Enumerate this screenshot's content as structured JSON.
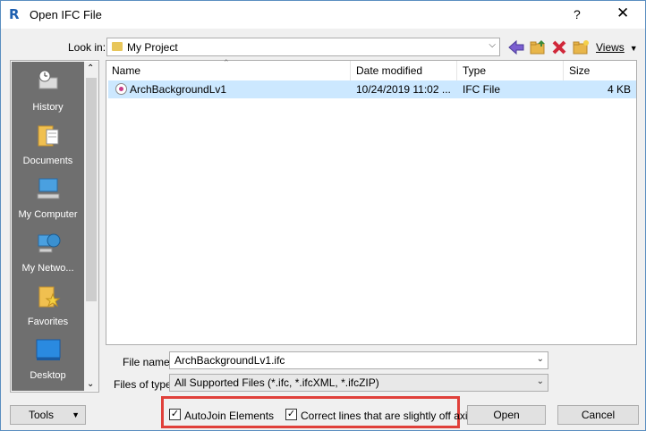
{
  "window": {
    "title": "Open IFC File",
    "app_icon_letter": "R",
    "help_glyph": "?",
    "close_glyph": "✕"
  },
  "lookin": {
    "label": "Look in:",
    "value": "My Project"
  },
  "toolbar": {
    "views_label": "Views"
  },
  "places": [
    {
      "label": "History"
    },
    {
      "label": "Documents"
    },
    {
      "label": "My Computer"
    },
    {
      "label": "My Netwo..."
    },
    {
      "label": "Favorites"
    },
    {
      "label": "Desktop"
    }
  ],
  "filelist": {
    "columns": [
      "Name",
      "Date modified",
      "Type",
      "Size"
    ],
    "rows": [
      {
        "name": "ArchBackgroundLv1",
        "date": "10/24/2019 11:02 ...",
        "type": "IFC File",
        "size": "4 KB"
      }
    ]
  },
  "filename": {
    "label": "File name:",
    "value": "ArchBackgroundLv1.ifc"
  },
  "filetype": {
    "label": "Files of type:",
    "value": "All Supported Files  (*.ifc, *.ifcXML, *.ifcZIP)"
  },
  "options": {
    "autojoin_label": "AutoJoin Elements",
    "autojoin_checked": true,
    "correct_lines_label": "Correct lines that are slightly off axis",
    "correct_lines_checked": true
  },
  "buttons": {
    "tools": "Tools",
    "open": "Open",
    "cancel": "Cancel"
  },
  "colors": {
    "selection": "#cce8ff",
    "places_bg": "#6f6f6f",
    "highlight": "#e0403a"
  }
}
